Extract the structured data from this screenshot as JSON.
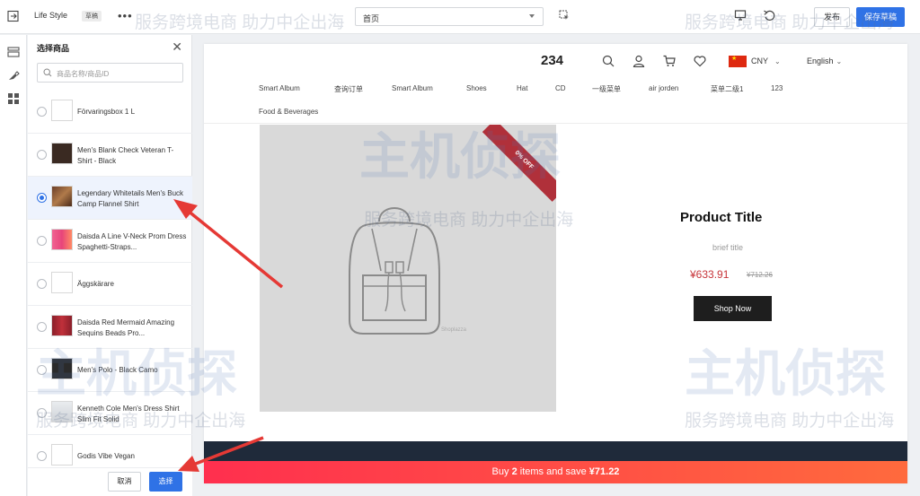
{
  "topbar": {
    "theme_name": "Life Style",
    "draft_badge": "草稿",
    "page_select_value": "首页",
    "publish_label": "发布",
    "save_draft_label": "保存草稿"
  },
  "panel": {
    "title": "选择商品",
    "search_placeholder": "商品名称/商品ID",
    "items": [
      {
        "name": "Förvaringsbox 1 L",
        "thumb": "blank",
        "selected": false
      },
      {
        "name": "Men's Blank Check Veteran T-Shirt - Black",
        "thumb": "#3a2a22",
        "selected": false
      },
      {
        "name": "Legendary Whitetails Men's Buck Camp Flannel Shirt",
        "thumb": "#6b3f2a",
        "selected": true
      },
      {
        "name": "Daisda A Line V-Neck Prom Dress Spaghetti-Straps...",
        "thumb": "#e8457a",
        "selected": false
      },
      {
        "name": "Äggskärare",
        "thumb": "blank",
        "selected": false
      },
      {
        "name": "Daisda Red Mermaid Amazing Sequins Beads Pro...",
        "thumb": "#8a1f2a",
        "selected": false
      },
      {
        "name": "Men's Polo - Black Camo",
        "thumb": "#2b2b2b",
        "selected": false
      },
      {
        "name": "Kenneth Cole Men's Dress Shirt Slim Fit Solid",
        "thumb": "#cfd3d8",
        "selected": false
      },
      {
        "name": "Godis Vibe Vegan",
        "thumb": "blank",
        "selected": false
      }
    ],
    "cancel_label": "取消",
    "select_label": "选择"
  },
  "preview": {
    "store_name": "234",
    "currency": "CNY",
    "language": "English",
    "nav": [
      "Smart Album",
      "查询订单",
      "Smart Album",
      "Shoes",
      "Hat",
      "CD",
      "一级菜单",
      "air jorden",
      "菜单二级1",
      "123",
      "Food & Beverages"
    ],
    "badge_text": "0% OFF",
    "image_brand": "Shoplazza",
    "product_title": "Product Title",
    "brief_title": "brief title",
    "price": "¥633.91",
    "compare_price": "¥712.26",
    "shop_now_label": "Shop Now",
    "promo_prefix": "Buy ",
    "promo_count": "2",
    "promo_middle": " items and save ",
    "promo_amount": "¥71.22"
  },
  "watermark": {
    "brand_text": "主机侦探",
    "slogan_text": "服务跨境电商  助力中企出海"
  },
  "colors": {
    "accent": "#2f72e6",
    "price_red": "#c7353a",
    "promo_start": "#ff2f4e",
    "promo_end": "#ff6a3d",
    "dark_band": "#1f2a3a",
    "annotation_arrow": "#e53935"
  }
}
